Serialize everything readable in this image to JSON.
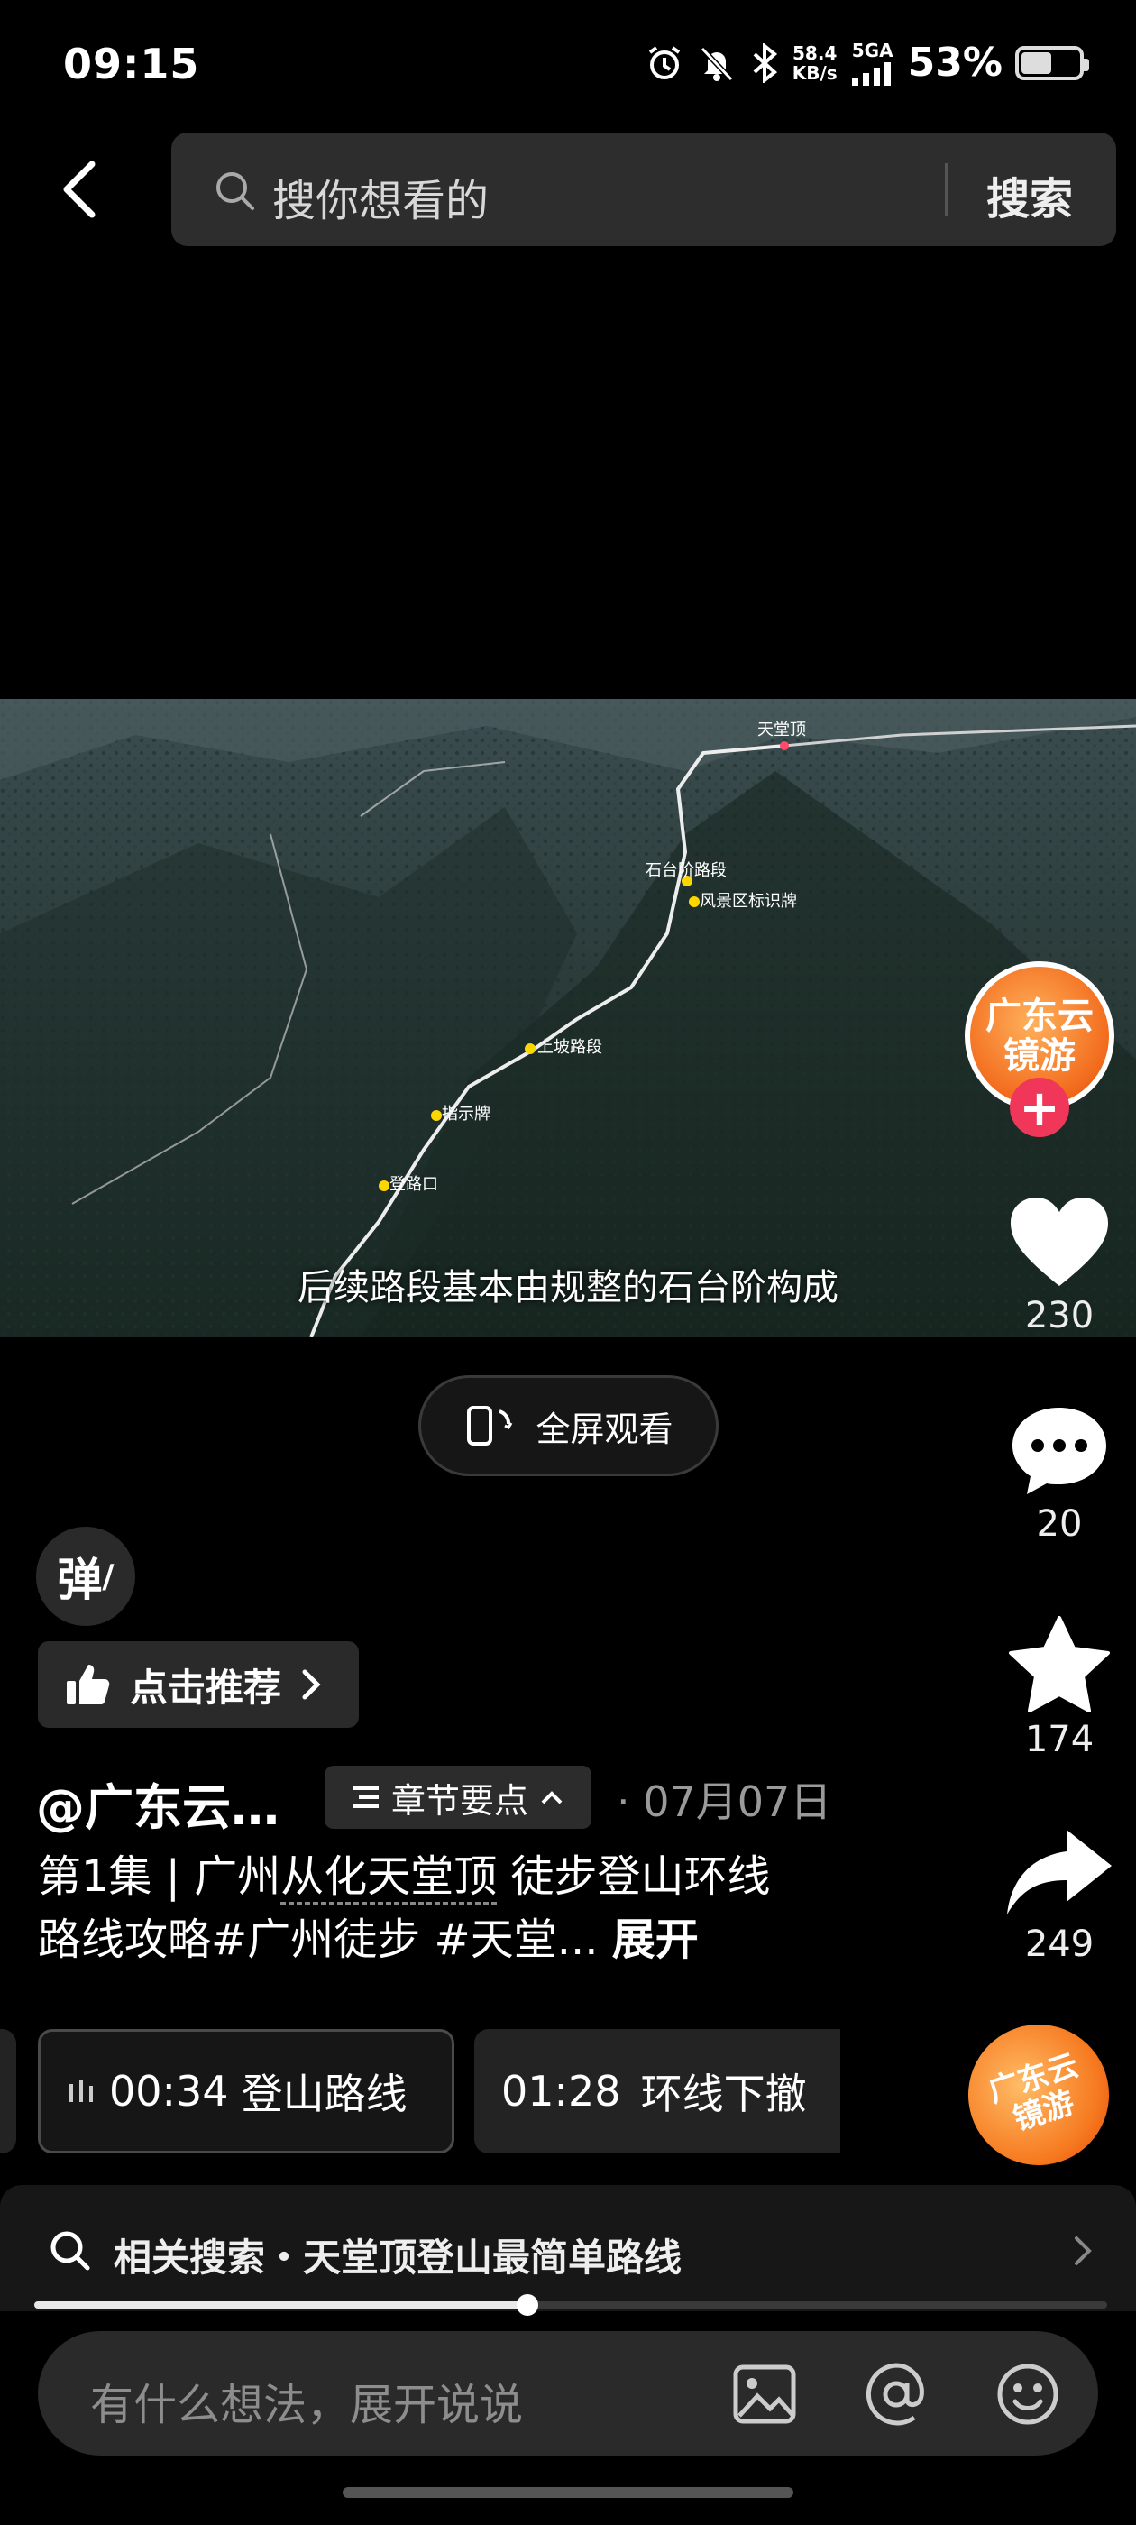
{
  "status_bar": {
    "time": "09:15",
    "net_speed_value": "58.4",
    "net_speed_unit": "KB/s",
    "network": "5GA",
    "battery": "53%",
    "battery_level": 0.53
  },
  "search": {
    "placeholder": "搜你想看的",
    "button": "搜索"
  },
  "video": {
    "subtitle": "后续路段基本由规整的石台阶构成",
    "map_labels": {
      "peak": "天堂顶",
      "stone_steps": "石台阶路段",
      "scenic_sign": "风景区标识牌",
      "slope": "上坡路段",
      "signpost": "指示牌",
      "trail_entrance": "登路口"
    }
  },
  "fullscreen_label": "全屏观看",
  "danmu_label": "弹",
  "recommend_label": "点击推荐",
  "post": {
    "author": "@广东云…",
    "chapter_label": "章节要点",
    "date": "07月07日",
    "desc_line1_a": "第1集 | 广州",
    "desc_line1_link": "从化天堂顶",
    "desc_line1_b": " 徒步登山环线",
    "desc_line2": "路线攻略#广州徒步 #天堂...",
    "expand": "展开"
  },
  "chapters": [
    {
      "time": "00:34",
      "title": "登山路线"
    },
    {
      "time": "01:28",
      "title": "环线下撤"
    }
  ],
  "side_actions": {
    "avatar_text": "广东云镜游",
    "likes": "230",
    "comments": "20",
    "favorites": "174",
    "shares": "249"
  },
  "related_search": "相关搜索・天堂顶登山最简单路线",
  "progress": 0.46,
  "comment_placeholder": "有什么想法，展开说说",
  "colors": {
    "background": "#000000",
    "follow": "#f0375a",
    "avatar": "#f26a1b"
  }
}
